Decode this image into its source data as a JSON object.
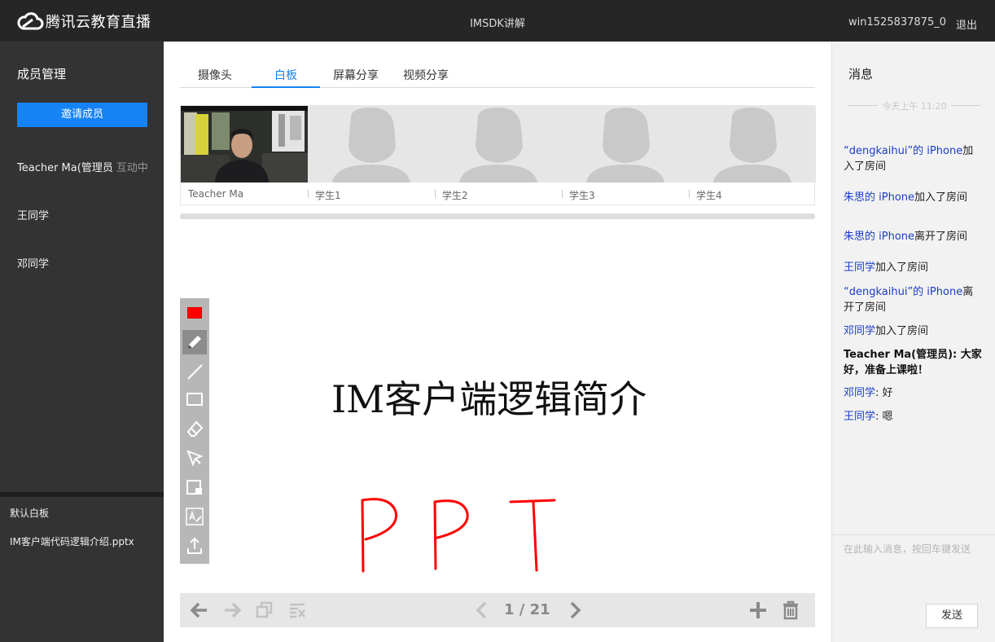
{
  "header": {
    "brand": "腾讯云教育直播",
    "title": "IMSDK讲解",
    "user": "win1525837875_0",
    "logout_label": "退出"
  },
  "left": {
    "title": "成员管理",
    "invite_label": "邀请成员",
    "members": [
      {
        "name": "Teacher Ma(管理员",
        "status": "互动中"
      },
      {
        "name": "王同学",
        "status": ""
      },
      {
        "name": "邓同学",
        "status": ""
      }
    ],
    "files": [
      "默认白板",
      "IM客户端代码逻辑介绍.pptx"
    ]
  },
  "main": {
    "tabs": [
      {
        "label": "摄像头",
        "active": false
      },
      {
        "label": "白板",
        "active": true
      },
      {
        "label": "屏幕分享",
        "active": false
      },
      {
        "label": "视频分享",
        "active": false
      }
    ],
    "video_slots": [
      "Teacher Ma",
      "学生1",
      "学生2",
      "学生3",
      "学生4"
    ],
    "slide_title": "IM客户端逻辑简介",
    "handwriting": "PPT",
    "page_indicator": "1 / 21",
    "pen_color": "#ff0000",
    "tools": [
      "color-swatch",
      "pen-icon",
      "line-icon",
      "rectangle-icon",
      "eraser-icon",
      "select-icon",
      "image-icon",
      "text-icon",
      "upload-icon"
    ]
  },
  "right": {
    "title": "消息",
    "time_divider": "今天上午 11:20",
    "messages": [
      {
        "who": "“dengkaihui”的 iPhone",
        "text": "加入了房间"
      },
      {
        "who": "朱思的 iPhone",
        "text": "加入了房间"
      },
      {
        "who": "朱思的 iPhone",
        "text": "离开了房间"
      },
      {
        "who": "王同学",
        "text": "加入了房间"
      },
      {
        "who": "“dengkaihui”的 iPhone",
        "text": "离开了房间"
      },
      {
        "who": "邓同学",
        "text": "加入了房间"
      },
      {
        "who": "",
        "text": "Teacher Ma(管理员): 大家好，准备上课啦！"
      },
      {
        "who": "邓同学",
        "text": ": 好"
      },
      {
        "who": "王同学",
        "text": ": 嗯"
      }
    ],
    "input_placeholder": "在此输入消息，按回车键发送",
    "send_label": "发送"
  },
  "colors": {
    "accent": "#1683f5",
    "topbar": "#262626",
    "sidebar": "#333333",
    "ink": "#ff0000"
  }
}
